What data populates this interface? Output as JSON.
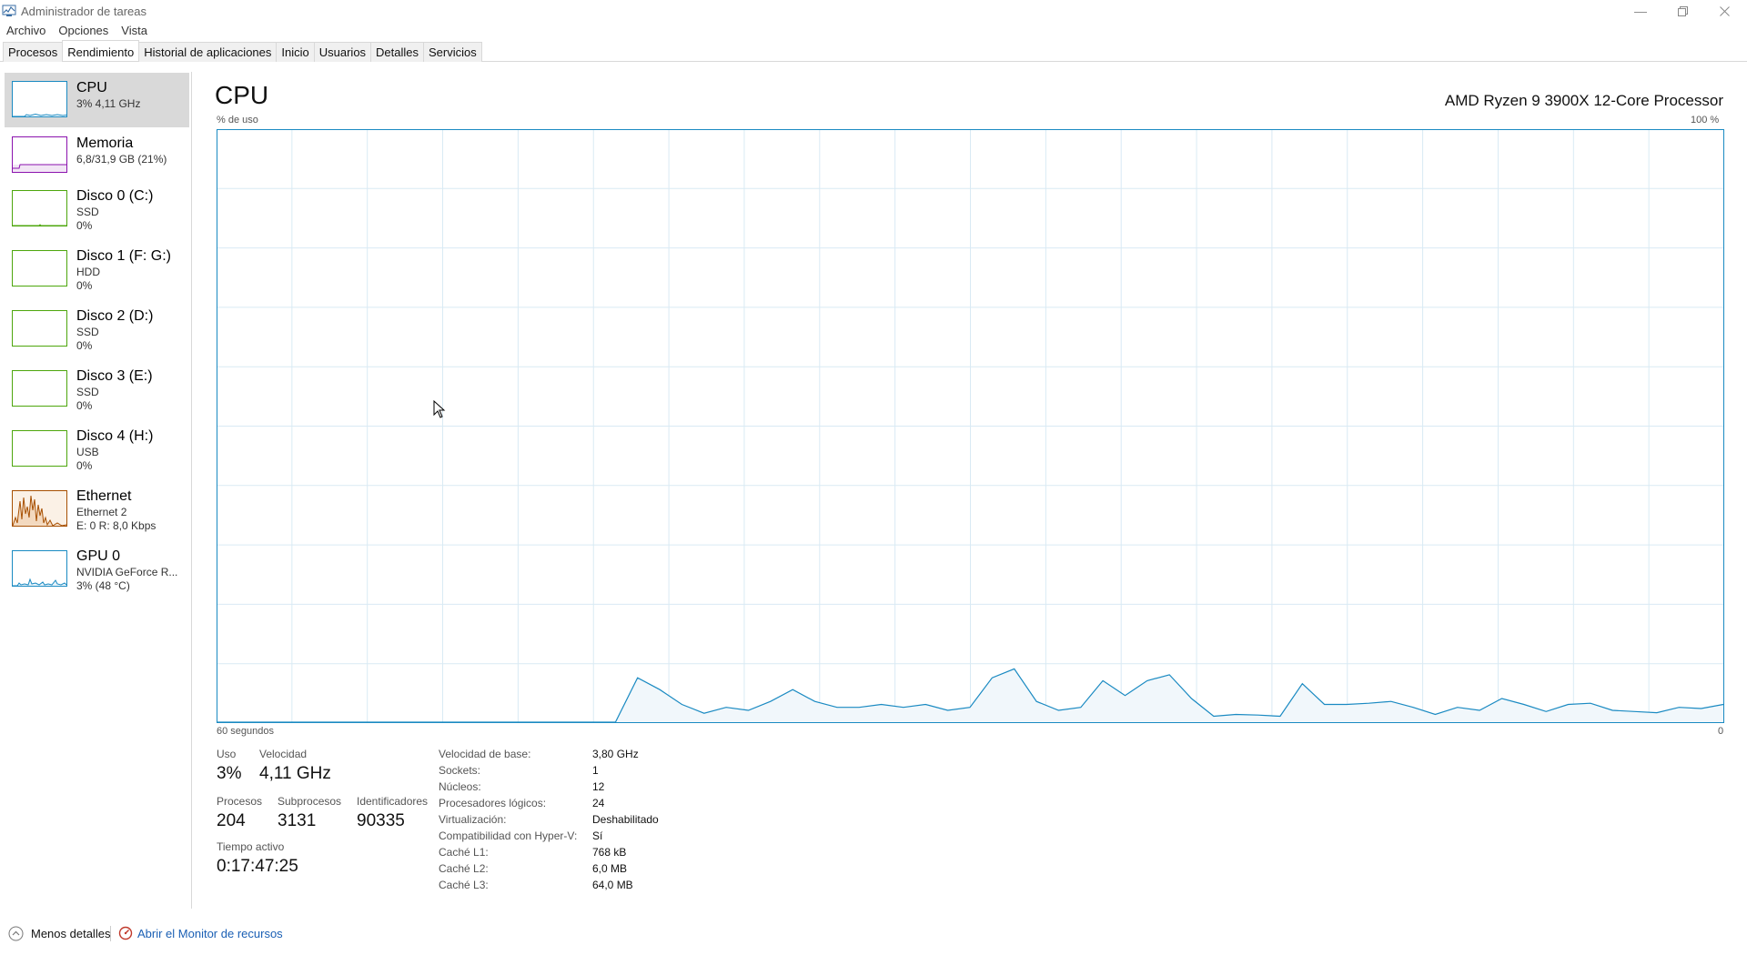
{
  "window": {
    "title": "Administrador de tareas",
    "minimize_icon": "minimize-icon",
    "maximize_icon": "restore-icon",
    "close_icon": "close-icon"
  },
  "menu": [
    "Archivo",
    "Opciones",
    "Vista"
  ],
  "tabs": [
    {
      "label": "Procesos",
      "active": false
    },
    {
      "label": "Rendimiento",
      "active": true
    },
    {
      "label": "Historial de aplicaciones",
      "active": false
    },
    {
      "label": "Inicio",
      "active": false
    },
    {
      "label": "Usuarios",
      "active": false
    },
    {
      "label": "Detalles",
      "active": false
    },
    {
      "label": "Servicios",
      "active": false
    }
  ],
  "sidebar": {
    "items": [
      {
        "name": "CPU",
        "sub1": "3% 4,11 GHz",
        "sub2": "",
        "color": "#1a8ac2"
      },
      {
        "name": "Memoria",
        "sub1": "6,8/31,9 GB (21%)",
        "sub2": "",
        "color": "#8b12ae"
      },
      {
        "name": "Disco 0 (C:)",
        "sub1": "SSD",
        "sub2": "0%",
        "color": "#4da60c"
      },
      {
        "name": "Disco 1 (F: G:)",
        "sub1": "HDD",
        "sub2": "0%",
        "color": "#4da60c"
      },
      {
        "name": "Disco 2 (D:)",
        "sub1": "SSD",
        "sub2": "0%",
        "color": "#4da60c"
      },
      {
        "name": "Disco 3 (E:)",
        "sub1": "SSD",
        "sub2": "0%",
        "color": "#4da60c"
      },
      {
        "name": "Disco 4 (H:)",
        "sub1": "USB",
        "sub2": "0%",
        "color": "#4da60c"
      },
      {
        "name": "Ethernet",
        "sub1": "Ethernet 2",
        "sub2": "E: 0 R: 8,0 Kbps",
        "color": "#a74f01"
      },
      {
        "name": "GPU 0",
        "sub1": "NVIDIA GeForce R...",
        "sub2": "3% (48 °C)",
        "color": "#1a8ac2"
      }
    ]
  },
  "main": {
    "title": "CPU",
    "processor": "AMD Ryzen 9 3900X 12-Core Processor",
    "y_label": "% de uso",
    "y_max_label": "100 %",
    "x_left_label": "60 segundos",
    "x_right_label": "0",
    "accent": "#1a8ac2"
  },
  "chart_data": {
    "type": "area",
    "ylim": [
      0,
      100
    ],
    "x": [
      60,
      58,
      56,
      54,
      52,
      50,
      48,
      46,
      44,
      42,
      40,
      38,
      36,
      34,
      32,
      30,
      28,
      26,
      24,
      22,
      20,
      18,
      16,
      14,
      12,
      10,
      8,
      6,
      4,
      2,
      0
    ],
    "values": [
      0,
      0,
      0,
      0,
      0,
      0,
      0,
      0,
      0,
      0,
      0,
      0,
      0,
      0,
      0,
      0,
      0,
      0,
      0,
      0,
      0,
      0,
      0,
      0,
      0,
      0,
      0,
      0,
      0,
      0,
      0
    ],
    "series_points": [
      [
        0,
        0
      ],
      [
        1,
        0
      ],
      [
        2,
        0
      ],
      [
        3,
        0
      ],
      [
        4,
        0
      ],
      [
        5,
        0
      ],
      [
        6,
        0
      ],
      [
        7,
        0
      ],
      [
        8,
        0
      ],
      [
        9,
        0
      ],
      [
        10,
        0
      ],
      [
        11,
        0
      ],
      [
        12,
        0
      ],
      [
        13,
        0
      ],
      [
        14,
        0
      ],
      [
        15,
        0
      ],
      [
        16,
        0
      ],
      [
        17,
        0
      ],
      [
        18,
        0
      ],
      [
        19,
        7.5
      ],
      [
        20,
        5.5
      ],
      [
        21,
        3
      ],
      [
        22,
        1.5
      ],
      [
        23,
        2.5
      ],
      [
        24,
        2
      ],
      [
        25,
        3.5
      ],
      [
        26,
        5.5
      ],
      [
        27,
        3.5
      ],
      [
        28,
        2.5
      ],
      [
        29,
        2.5
      ],
      [
        30,
        3
      ],
      [
        31,
        2.5
      ],
      [
        32,
        3
      ],
      [
        33,
        2
      ],
      [
        34,
        2.5
      ],
      [
        35,
        7.5
      ],
      [
        36,
        9
      ],
      [
        37,
        3.5
      ],
      [
        38,
        2
      ],
      [
        39,
        2.5
      ],
      [
        40,
        7
      ],
      [
        41,
        4.5
      ],
      [
        42,
        7
      ],
      [
        43,
        8
      ],
      [
        44,
        4
      ],
      [
        45,
        1
      ],
      [
        46,
        1.3
      ],
      [
        47,
        1.2
      ],
      [
        48,
        1
      ],
      [
        49,
        6.5
      ],
      [
        50,
        3
      ],
      [
        51,
        3
      ],
      [
        52,
        3.2
      ],
      [
        53,
        3.5
      ],
      [
        54,
        2.5
      ],
      [
        55,
        1.3
      ],
      [
        56,
        2.5
      ],
      [
        57,
        2
      ],
      [
        58,
        4
      ],
      [
        59,
        3
      ],
      [
        60,
        1.8
      ],
      [
        61,
        3
      ],
      [
        62,
        3.2
      ],
      [
        63,
        2
      ],
      [
        64,
        1.8
      ],
      [
        65,
        1.6
      ],
      [
        66,
        2.5
      ],
      [
        67,
        2.3
      ],
      [
        68,
        3
      ]
    ]
  },
  "stats": {
    "uso_label": "Uso",
    "uso_value": "3%",
    "velocidad_label": "Velocidad",
    "velocidad_value": "4,11 GHz",
    "procesos_label": "Procesos",
    "procesos_value": "204",
    "subprocesos_label": "Subprocesos",
    "subprocesos_value": "3131",
    "identificadores_label": "Identificadores",
    "identificadores_value": "90335",
    "tiempo_label": "Tiempo activo",
    "tiempo_value": "0:17:47:25"
  },
  "specs": [
    {
      "label": "Velocidad de base:",
      "value": "3,80 GHz"
    },
    {
      "label": "Sockets:",
      "value": "1"
    },
    {
      "label": "Núcleos:",
      "value": "12"
    },
    {
      "label": "Procesadores lógicos:",
      "value": "24"
    },
    {
      "label": "Virtualización:",
      "value": "Deshabilitado"
    },
    {
      "label": "Compatibilidad con Hyper-V:",
      "value": "Sí"
    },
    {
      "label": "Caché L1:",
      "value": "768 kB"
    },
    {
      "label": "Caché L2:",
      "value": "6,0 MB"
    },
    {
      "label": "Caché L3:",
      "value": "64,0 MB"
    }
  ],
  "footer": {
    "less_details": "Menos detalles",
    "resource_monitor": "Abrir el Monitor de recursos",
    "link_color": "#1a5fb4"
  }
}
